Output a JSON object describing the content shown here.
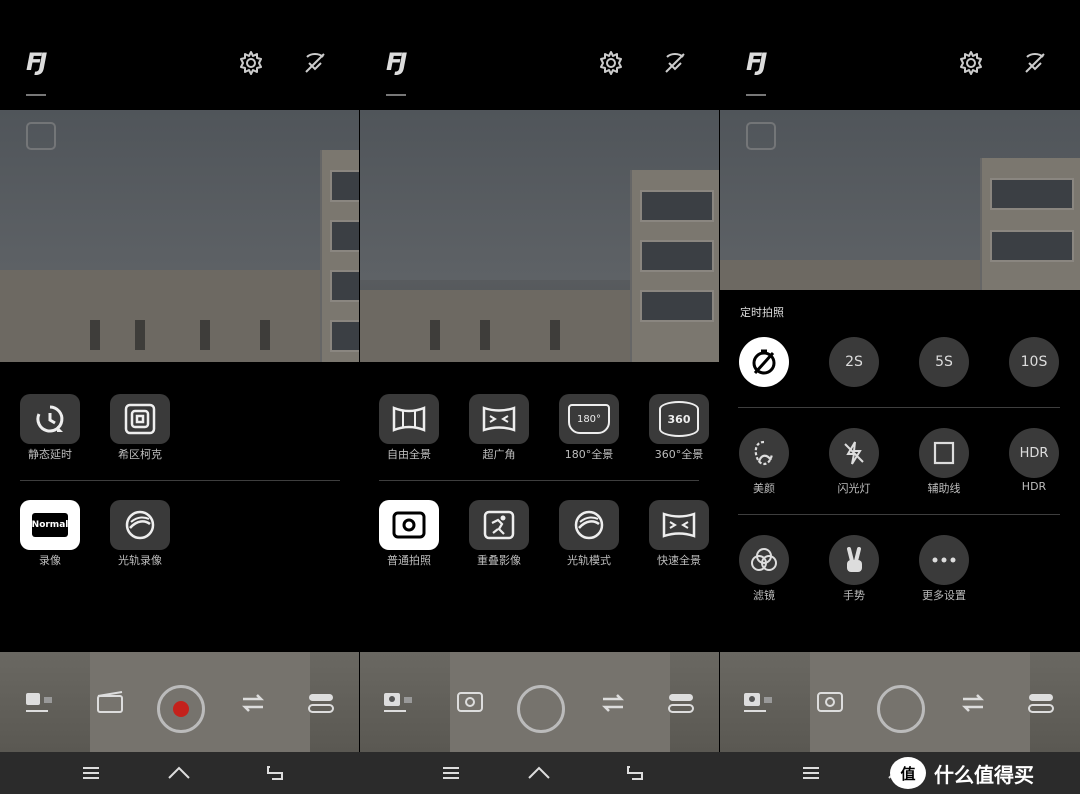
{
  "logo": "FJ",
  "panel1": {
    "row1": [
      {
        "icon": "timelapse-icon",
        "label": "静态延时"
      },
      {
        "icon": "hitchcock-icon",
        "label": "希区柯克"
      }
    ],
    "row2": [
      {
        "icon": "normal-video-icon",
        "label": "录像",
        "badge": "Normal",
        "selected": true
      },
      {
        "icon": "light-trail-video-icon",
        "label": "光轨录像"
      }
    ]
  },
  "panel2": {
    "row1": [
      {
        "label": "自由全景"
      },
      {
        "label": "超广角"
      },
      {
        "label": "180°全景",
        "badge": "180°"
      },
      {
        "label": "360°全景",
        "badge": "360"
      }
    ],
    "row2": [
      {
        "label": "普通拍照",
        "selected": true
      },
      {
        "label": "重叠影像"
      },
      {
        "label": "光轨模式"
      },
      {
        "label": "快速全景"
      }
    ]
  },
  "panel3": {
    "title": "定时拍照",
    "timer_options": [
      "2S",
      "5S",
      "10S"
    ],
    "row2": [
      {
        "label": "美颜"
      },
      {
        "label": "闪光灯"
      },
      {
        "label": "辅助线"
      },
      {
        "label": "HDR",
        "badge": "HDR"
      }
    ],
    "row3": [
      {
        "label": "滤镜"
      },
      {
        "label": "手势"
      },
      {
        "label": "更多设置"
      }
    ]
  },
  "watermark": {
    "badge": "值",
    "text": "什么值得买"
  },
  "colors": {
    "record": "#c4221c",
    "sheet": "#000000",
    "button": "#3a3a3a"
  }
}
